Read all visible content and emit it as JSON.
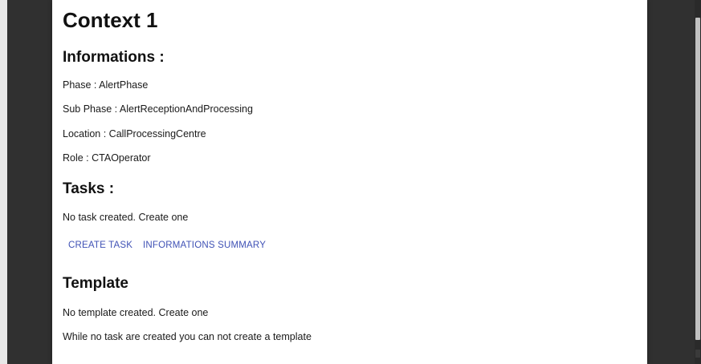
{
  "context": {
    "title": "Context 1"
  },
  "informations": {
    "heading": "Informations :",
    "phase": "Phase : AlertPhase",
    "sub_phase": "Sub Phase : AlertReceptionAndProcessing",
    "location": "Location : CallProcessingCentre",
    "role": "Role : CTAOperator"
  },
  "tasks": {
    "heading": "Tasks :",
    "empty_message": "No task created. Create one",
    "create_task_label": "CREATE TASK",
    "informations_summary_label": "INFORMATIONS SUMMARY"
  },
  "template": {
    "heading": "Template",
    "empty_message": "No template created. Create one",
    "notice": "While no task are created you can not create a template"
  },
  "colors": {
    "backdrop": "#303030",
    "panel": "#ffffff",
    "link": "#3f51b5"
  }
}
